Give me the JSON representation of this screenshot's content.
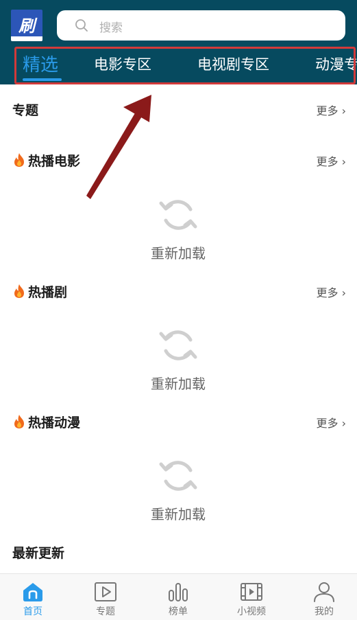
{
  "header": {
    "search_placeholder": "搜索",
    "tabs": [
      {
        "label": "精选",
        "active": true
      },
      {
        "label": "电影专区",
        "active": false
      },
      {
        "label": "电视剧专区",
        "active": false
      },
      {
        "label": "动漫专",
        "active": false
      }
    ]
  },
  "sections": [
    {
      "title": "专题",
      "more": "更多 ›",
      "fire": false
    },
    {
      "title": "热播电影",
      "more": "更多 ›",
      "fire": true,
      "reload": "重新加载"
    },
    {
      "title": "热播剧",
      "more": "更多 ›",
      "fire": true,
      "reload": "重新加载"
    },
    {
      "title": "热播动漫",
      "more": "更多 ›",
      "fire": true,
      "reload": "重新加载"
    },
    {
      "title": "最新更新"
    }
  ],
  "bottom_nav": [
    {
      "label": "首页",
      "icon": "home-icon",
      "active": true
    },
    {
      "label": "专题",
      "icon": "play-square-icon",
      "active": false
    },
    {
      "label": "榜单",
      "icon": "bar-chart-icon",
      "active": false
    },
    {
      "label": "小视频",
      "icon": "film-icon",
      "active": false
    },
    {
      "label": "我的",
      "icon": "user-icon",
      "active": false
    }
  ],
  "colors": {
    "header_bg": "#064a5f",
    "accent": "#2a9bea",
    "highlight": "#d23a3a",
    "arrow": "#8b1a1a"
  }
}
